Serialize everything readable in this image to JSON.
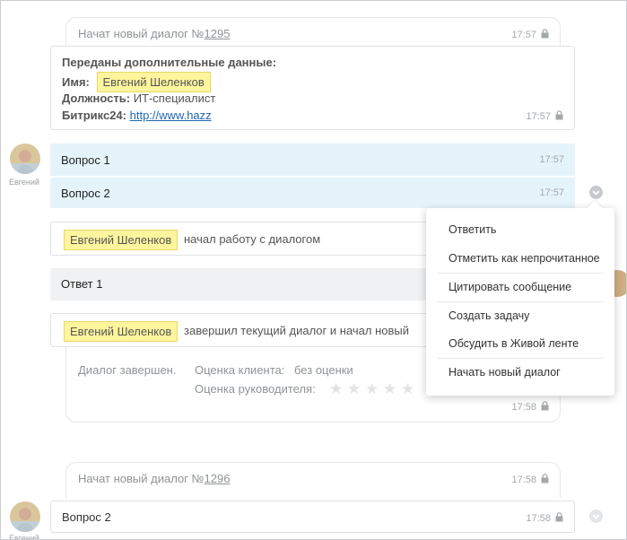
{
  "dialog_1295": {
    "header_prefix": "Начат новый диалог №",
    "number": "1295",
    "time": "17:57",
    "data": {
      "title": "Переданы дополнительные данные:",
      "name_label": "Имя:",
      "name_value": "Евгений Шеленков",
      "position_label": "Должность:",
      "position_value": "ИТ-специалист",
      "bitrix_label": "Битрикс24:",
      "bitrix_value": "http://www.hazz",
      "time": "17:57"
    }
  },
  "client": {
    "name": "Евгений"
  },
  "messages": [
    {
      "text": "Вопрос 1",
      "time": "17:57"
    },
    {
      "text": "Вопрос 2",
      "time": "17:57"
    }
  ],
  "event_start": {
    "user": "Евгений Шеленков",
    "text": "начал работу с диалогом"
  },
  "answer": {
    "text": "Ответ 1"
  },
  "event_finish": {
    "user": "Евгений Шеленков",
    "text": "завершил текущий диалог и начал новый"
  },
  "summary": {
    "status": "Диалог завершен.",
    "client_rating_label": "Оценка клиента:",
    "client_rating_value": "без оценки",
    "manager_rating_label": "Оценка руководителя:",
    "manager_stars": 5,
    "time": "17:58"
  },
  "dialog_1296": {
    "header_prefix": "Начат новый диалог №",
    "number": "1296",
    "time": "17:58"
  },
  "last_message": {
    "text": "Вопрос 2",
    "time": "17:58"
  },
  "context_menu": {
    "items": [
      "Ответить",
      "Отметить как непрочитанное",
      "Цитировать сообщение",
      "Создать задачу",
      "Обсудить в Живой ленте",
      "Начать новый диалог"
    ]
  },
  "colors": {
    "highlight": "#fff59d",
    "bubble_client": "#e5f4fb",
    "bubble_operator": "#f0f1f2",
    "link": "#2067b0"
  },
  "icons": [
    "lock-icon",
    "chevron-down-icon",
    "star-icon",
    "avatar"
  ]
}
